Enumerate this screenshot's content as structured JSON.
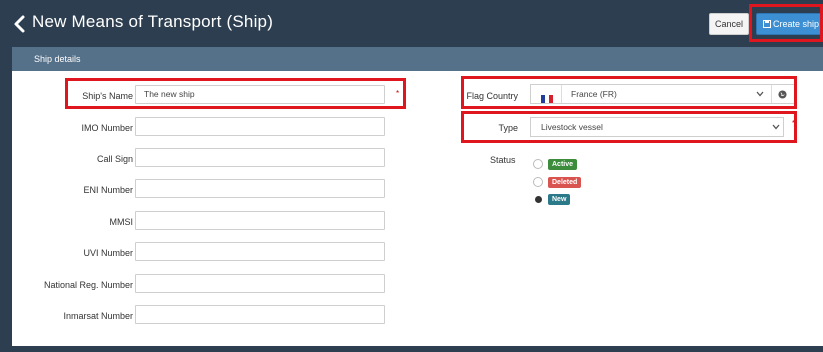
{
  "header": {
    "title": "New Means of Transport (Ship)",
    "cancel_label": "Cancel",
    "create_label": "Create ship"
  },
  "panel": {
    "title": "Ship details"
  },
  "form": {
    "ship_name": {
      "label": "Ship's Name",
      "value": "The new ship",
      "required_mark": "*"
    },
    "imo_number": {
      "label": "IMO Number",
      "value": ""
    },
    "call_sign": {
      "label": "Call Sign",
      "value": ""
    },
    "eni_number": {
      "label": "ENI Number",
      "value": ""
    },
    "mmsi": {
      "label": "MMSI",
      "value": ""
    },
    "uvi_number": {
      "label": "UVI Number",
      "value": ""
    },
    "national_reg_number": {
      "label": "National Reg. Number",
      "value": ""
    },
    "inmarsat_number": {
      "label": "Inmarsat Number",
      "value": ""
    },
    "flag_country": {
      "label": "Flag Country",
      "value": "France (FR)"
    },
    "type": {
      "label": "Type",
      "value": "Livestock vessel",
      "required_mark": "*"
    },
    "status": {
      "label": "Status",
      "options": [
        {
          "label": "Active",
          "color": "#3c8c3c",
          "selected": false
        },
        {
          "label": "Deleted",
          "color": "#d9534f",
          "selected": false
        },
        {
          "label": "New",
          "color": "#2b7a8a",
          "selected": true
        }
      ]
    }
  },
  "colors": {
    "header_bg": "#2c3e50",
    "panel_header_bg": "#557089",
    "primary_button": "#3d8fd3",
    "highlight": "#e0161e"
  }
}
